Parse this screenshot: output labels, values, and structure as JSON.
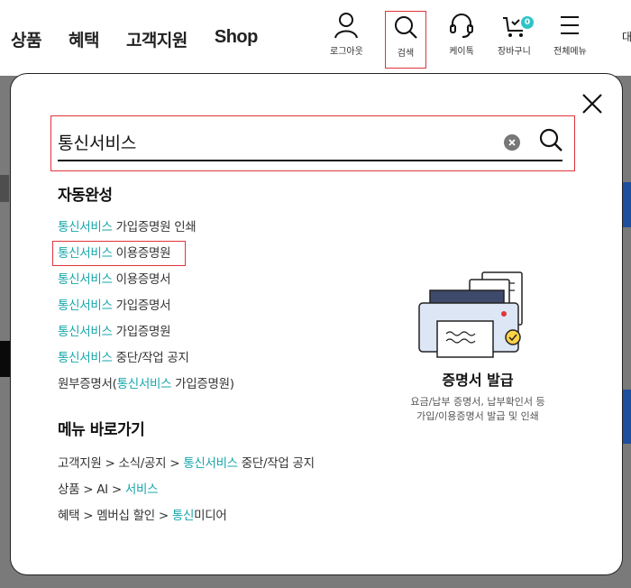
{
  "header": {
    "nav": [
      "상품",
      "혜택",
      "고객지원",
      "Shop"
    ],
    "util": [
      {
        "icon": "person-icon",
        "label": "로그아웃"
      },
      {
        "icon": "search-icon",
        "label": "검색"
      },
      {
        "icon": "headset-icon",
        "label": "케이톡"
      },
      {
        "icon": "cart-icon",
        "label": "장바구니",
        "badge": "0"
      },
      {
        "icon": "menu-icon",
        "label": "전체메뉴"
      }
    ],
    "cut_text": "대"
  },
  "search": {
    "value": "통신서비스"
  },
  "autocomplete": {
    "title": "자동완성",
    "items": [
      {
        "hl": "통신서비스",
        "rest": " 가입증명원 인쇄"
      },
      {
        "hl": "통신서비스",
        "rest": " 이용증명원"
      },
      {
        "hl": "통신서비스",
        "rest": " 이용증명서"
      },
      {
        "hl": "통신서비스",
        "rest": " 가입증명서"
      },
      {
        "hl": "통신서비스",
        "rest": " 가입증명원"
      },
      {
        "hl": "통신서비스",
        "rest": " 중단/작업 공지"
      },
      {
        "pre": "원부증명서(",
        "hl": "통신서비스",
        "rest": " 가입증명원)"
      }
    ]
  },
  "menu_shortcut": {
    "title": "메뉴 바로가기",
    "items": [
      {
        "pre": "고객지원 > 소식/공지 > ",
        "hl": "통신서비스",
        "rest": " 중단/작업 공지"
      },
      {
        "pre": "상품 > AI > ",
        "hl": "서비스",
        "rest": ""
      },
      {
        "pre": "혜택 > 멤버십 할인 > ",
        "hl": "통신",
        "rest": "미디어"
      }
    ]
  },
  "promo": {
    "title": "증명서 발급",
    "desc_line1": "요금/납부 증명서, 납부확인서 등",
    "desc_line2": "가입/이용증명서 발급 및 인쇄"
  },
  "colors": {
    "highlight": "#17a6ab",
    "focus_border": "#e0343a",
    "badge": "#2ec4c7"
  }
}
